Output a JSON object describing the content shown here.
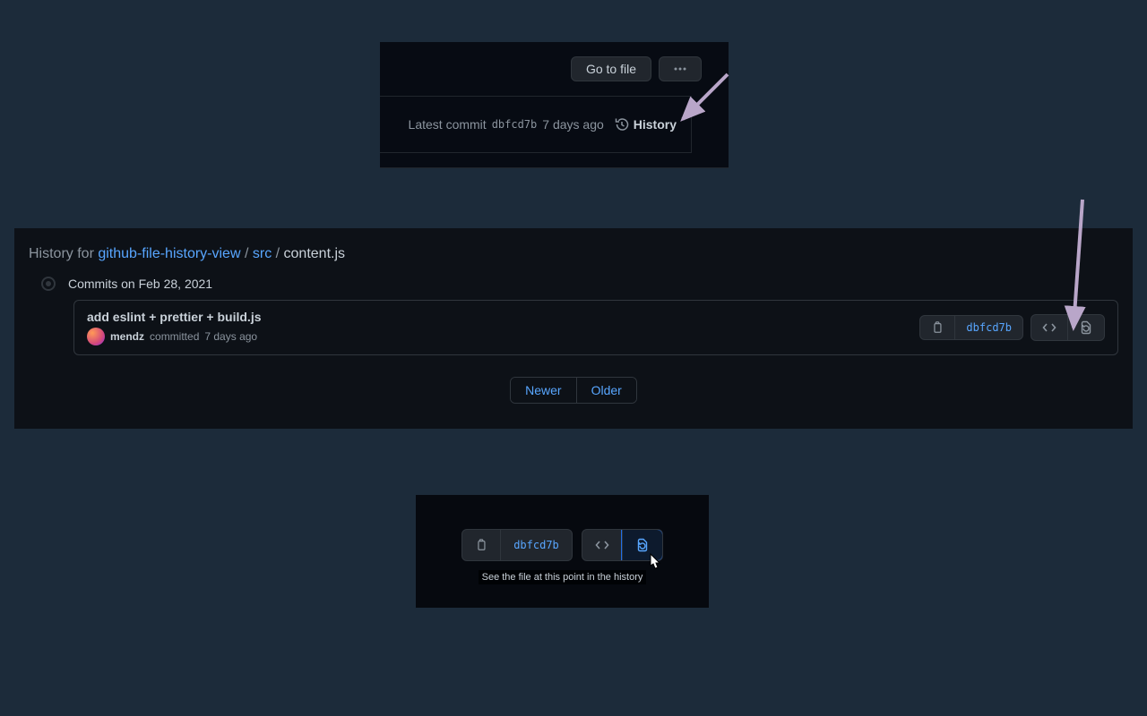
{
  "panel1": {
    "go_to_file": "Go to file",
    "latest_commit_label": "Latest commit",
    "commit_hash": "dbfcd7b",
    "commit_age": "7 days ago",
    "history_label": "History"
  },
  "panel2": {
    "breadcrumb_prefix": "History for ",
    "repo": "github-file-history-view",
    "folder": "src",
    "file": "content.js",
    "date_heading": "Commits on Feb 28, 2021",
    "commit": {
      "title": "add eslint + prettier + build.js",
      "author": "mendz",
      "verb": "committed",
      "age": "7 days ago",
      "hash": "dbfcd7b"
    },
    "pager_newer": "Newer",
    "pager_older": "Older"
  },
  "panel3": {
    "hash": "dbfcd7b",
    "tooltip": "See the file at this point in the history"
  }
}
